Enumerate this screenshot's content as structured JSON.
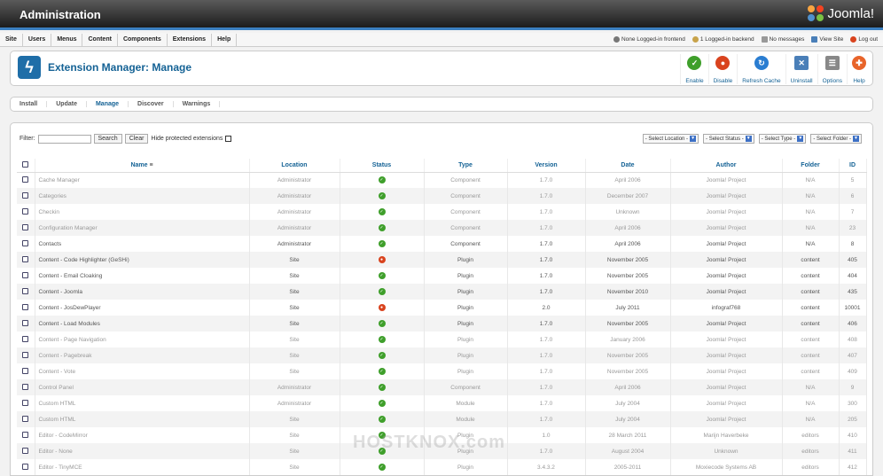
{
  "app": {
    "title": "Administration",
    "brand": "Joomla!"
  },
  "menu": [
    "Site",
    "Users",
    "Menus",
    "Content",
    "Components",
    "Extensions",
    "Help"
  ],
  "status": {
    "frontend": "None Logged-in frontend",
    "backend": "1 Logged-in backend",
    "messages": "No messages",
    "view_site": "View Site",
    "logout": "Log out"
  },
  "page": {
    "title": "Extension Manager: Manage"
  },
  "toolbar": [
    {
      "label": "Enable",
      "icon": "check-icon",
      "color": "#3f9f2b"
    },
    {
      "label": "Disable",
      "icon": "disable-icon",
      "color": "#d9431e"
    },
    {
      "label": "Refresh Cache",
      "icon": "refresh-icon",
      "color": "#2a7dd1"
    },
    {
      "label": "Uninstall",
      "icon": "trash-icon",
      "color": "#4a7fb8"
    },
    {
      "label": "Options",
      "icon": "options-icon",
      "color": "#888888"
    },
    {
      "label": "Help",
      "icon": "help-icon",
      "color": "#e8642a"
    }
  ],
  "subnav": [
    {
      "label": "Install"
    },
    {
      "label": "Update"
    },
    {
      "label": "Manage",
      "active": true
    },
    {
      "label": "Discover"
    },
    {
      "label": "Warnings"
    }
  ],
  "filter": {
    "label": "Filter:",
    "search_label": "Search",
    "clear_label": "Clear",
    "hide_protected": "Hide protected extensions"
  },
  "selects": [
    "- Select Location -",
    "- Select Status -",
    "- Select Type -",
    "- Select Folder -"
  ],
  "columns": [
    "Name",
    "Location",
    "Status",
    "Type",
    "Version",
    "Date",
    "Author",
    "Folder",
    "ID"
  ],
  "rows": [
    {
      "name": "Cache Manager",
      "location": "Administrator",
      "status": "ok",
      "type": "Component",
      "version": "1.7.0",
      "date": "April 2006",
      "author": "Joomla! Project",
      "folder": "N/A",
      "id": "5",
      "grey": true
    },
    {
      "name": "Categories",
      "location": "Administrator",
      "status": "ok",
      "type": "Component",
      "version": "1.7.0",
      "date": "December 2007",
      "author": "Joomla! Project",
      "folder": "N/A",
      "id": "6",
      "grey": true
    },
    {
      "name": "Checkin",
      "location": "Administrator",
      "status": "ok",
      "type": "Component",
      "version": "1.7.0",
      "date": "Unknown",
      "author": "Joomla! Project",
      "folder": "N/A",
      "id": "7",
      "grey": true
    },
    {
      "name": "Configuration Manager",
      "location": "Administrator",
      "status": "ok",
      "type": "Component",
      "version": "1.7.0",
      "date": "April 2006",
      "author": "Joomla! Project",
      "folder": "N/A",
      "id": "23",
      "grey": true
    },
    {
      "name": "Contacts",
      "location": "Administrator",
      "status": "ok",
      "type": "Component",
      "version": "1.7.0",
      "date": "April 2006",
      "author": "Joomla! Project",
      "folder": "N/A",
      "id": "8",
      "grey": false
    },
    {
      "name": "Content - Code Highlighter (GeSHi)",
      "location": "Site",
      "status": "no",
      "type": "Plugin",
      "version": "1.7.0",
      "date": "November 2005",
      "author": "Joomla! Project",
      "folder": "content",
      "id": "405",
      "grey": false
    },
    {
      "name": "Content - Email Cloaking",
      "location": "Site",
      "status": "ok",
      "type": "Plugin",
      "version": "1.7.0",
      "date": "November 2005",
      "author": "Joomla! Project",
      "folder": "content",
      "id": "404",
      "grey": false
    },
    {
      "name": "Content - Joomla",
      "location": "Site",
      "status": "ok",
      "type": "Plugin",
      "version": "1.7.0",
      "date": "November 2010",
      "author": "Joomla! Project",
      "folder": "content",
      "id": "435",
      "grey": false
    },
    {
      "name": "Content - JosDewPlayer",
      "location": "Site",
      "status": "no",
      "type": "Plugin",
      "version": "2.0",
      "date": "July 2011",
      "author": "infograf768",
      "folder": "content",
      "id": "10001",
      "grey": false
    },
    {
      "name": "Content - Load Modules",
      "location": "Site",
      "status": "ok",
      "type": "Plugin",
      "version": "1.7.0",
      "date": "November 2005",
      "author": "Joomla! Project",
      "folder": "content",
      "id": "406",
      "grey": false
    },
    {
      "name": "Content - Page Navigation",
      "location": "Site",
      "status": "ok",
      "type": "Plugin",
      "version": "1.7.0",
      "date": "January 2006",
      "author": "Joomla! Project",
      "folder": "content",
      "id": "408",
      "grey": true
    },
    {
      "name": "Content - Pagebreak",
      "location": "Site",
      "status": "ok",
      "type": "Plugin",
      "version": "1.7.0",
      "date": "November 2005",
      "author": "Joomla! Project",
      "folder": "content",
      "id": "407",
      "grey": true
    },
    {
      "name": "Content - Vote",
      "location": "Site",
      "status": "ok",
      "type": "Plugin",
      "version": "1.7.0",
      "date": "November 2005",
      "author": "Joomla! Project",
      "folder": "content",
      "id": "409",
      "grey": true
    },
    {
      "name": "Control Panel",
      "location": "Administrator",
      "status": "ok",
      "type": "Component",
      "version": "1.7.0",
      "date": "April 2006",
      "author": "Joomla! Project",
      "folder": "N/A",
      "id": "9",
      "grey": true
    },
    {
      "name": "Custom HTML",
      "location": "Administrator",
      "status": "ok",
      "type": "Module",
      "version": "1.7.0",
      "date": "July 2004",
      "author": "Joomla! Project",
      "folder": "N/A",
      "id": "300",
      "grey": true
    },
    {
      "name": "Custom HTML",
      "location": "Site",
      "status": "ok",
      "type": "Module",
      "version": "1.7.0",
      "date": "July 2004",
      "author": "Joomla! Project",
      "folder": "N/A",
      "id": "205",
      "grey": true
    },
    {
      "name": "Editor - CodeMirror",
      "location": "Site",
      "status": "ok",
      "type": "Plugin",
      "version": "1.0",
      "date": "28 March 2011",
      "author": "Marijn Haverbeke",
      "folder": "editors",
      "id": "410",
      "grey": true
    },
    {
      "name": "Editor - None",
      "location": "Site",
      "status": "ok",
      "type": "Plugin",
      "version": "1.7.0",
      "date": "August 2004",
      "author": "Unknown",
      "folder": "editors",
      "id": "411",
      "grey": true
    },
    {
      "name": "Editor - TinyMCE",
      "location": "Site",
      "status": "ok",
      "type": "Plugin",
      "version": "3.4.3.2",
      "date": "2005-2011",
      "author": "Moxiecode Systems AB",
      "folder": "editors",
      "id": "412",
      "grey": true
    }
  ],
  "watermark": "HOSTKNOX.com"
}
